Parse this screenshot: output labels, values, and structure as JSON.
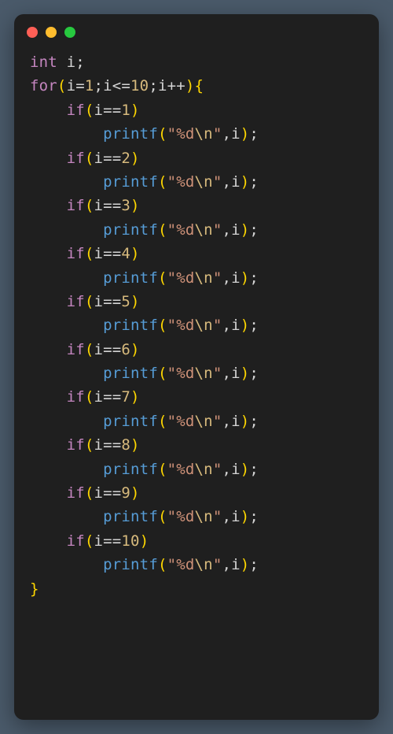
{
  "code": {
    "decl_kw": "int",
    "var": "i",
    "for_kw": "for",
    "for_init_var": "i",
    "for_init_op": "=",
    "for_init_val": "1",
    "for_cond_var": "i",
    "for_cond_op": "<=",
    "for_cond_val": "10",
    "for_iter_var": "i",
    "for_iter_op": "++",
    "if_kw": "if",
    "ifs": [
      {
        "cond_var": "i",
        "cond_op": "==",
        "cond_val": "1"
      },
      {
        "cond_var": "i",
        "cond_op": "==",
        "cond_val": "2"
      },
      {
        "cond_var": "i",
        "cond_op": "==",
        "cond_val": "3"
      },
      {
        "cond_var": "i",
        "cond_op": "==",
        "cond_val": "4"
      },
      {
        "cond_var": "i",
        "cond_op": "==",
        "cond_val": "5"
      },
      {
        "cond_var": "i",
        "cond_op": "==",
        "cond_val": "6"
      },
      {
        "cond_var": "i",
        "cond_op": "==",
        "cond_val": "7"
      },
      {
        "cond_var": "i",
        "cond_op": "==",
        "cond_val": "8"
      },
      {
        "cond_var": "i",
        "cond_op": "==",
        "cond_val": "9"
      },
      {
        "cond_var": "i",
        "cond_op": "==",
        "cond_val": "10"
      }
    ],
    "printf_fn": "printf",
    "printf_fmt_open": "\"",
    "printf_fmt_body": "%d",
    "printf_fmt_esc": "\\n",
    "printf_fmt_close": "\"",
    "printf_arg": "i"
  }
}
